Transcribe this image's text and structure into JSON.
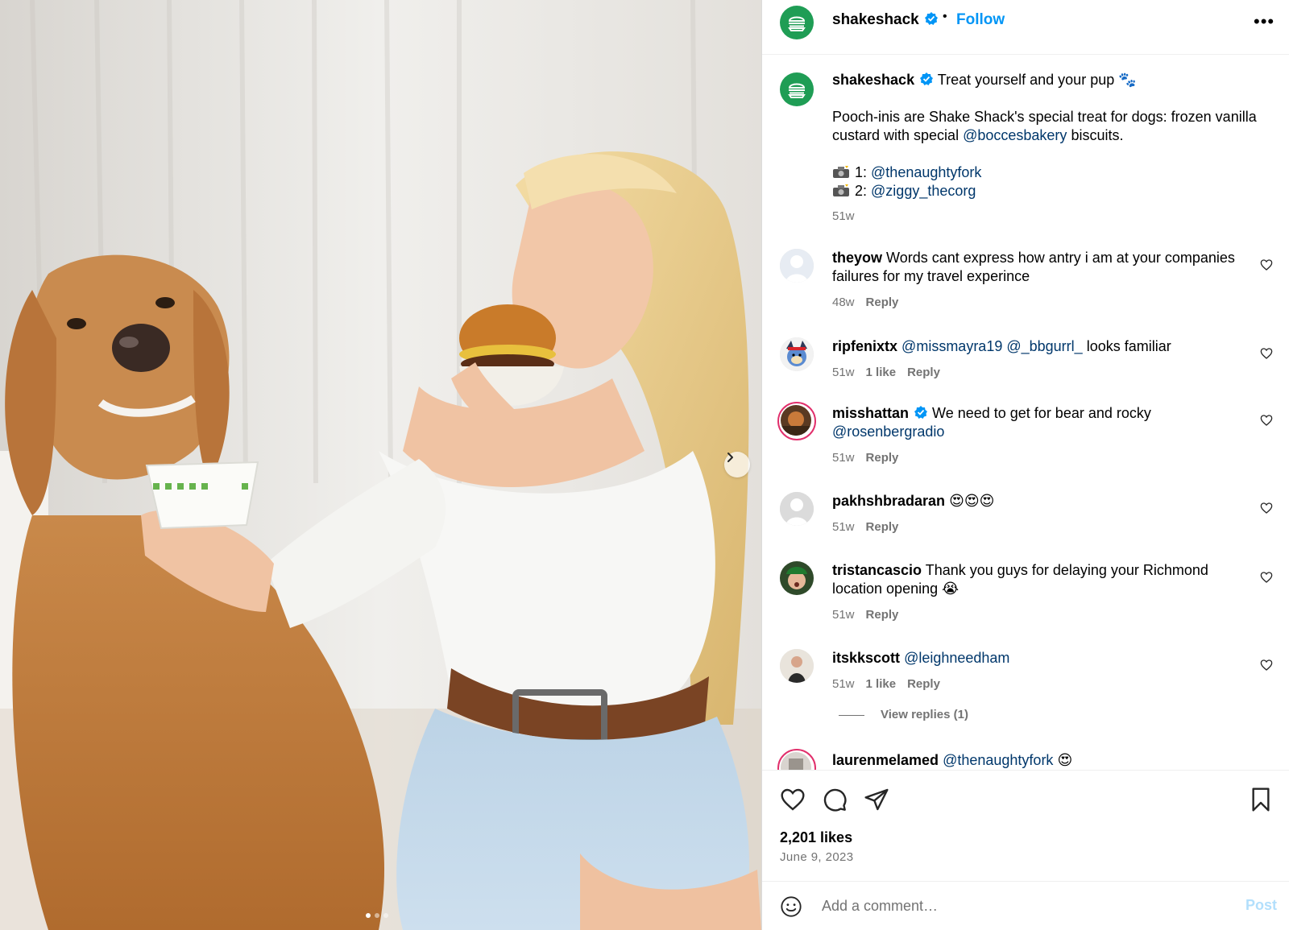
{
  "post": {
    "username": "shakeshack",
    "follow_label": "Follow",
    "separator": "•",
    "more_label": "•••",
    "caption": {
      "headline": "Treat yourself and your pup 🐾",
      "body_pre": "Pooch-inis are Shake Shack's special treat for dogs: frozen vanilla custard with special",
      "body_mention": "@boccesbakery",
      "body_post": "biscuits.",
      "credit1_prefix": "1:",
      "credit1_mention": "@thenaughtyfork",
      "credit2_prefix": "2:",
      "credit2_mention": "@ziggy_thecorg",
      "time": "51w"
    },
    "comments": [
      {
        "user": "theyow",
        "text": "Words cant express how antry i am at your companies failures for my travel experince",
        "time": "48w",
        "likes": "",
        "reply": "Reply"
      },
      {
        "user": "ripfenixtx",
        "mention1": "@missmayra19",
        "mention2": "@_bbgurrl_",
        "text": "looks familiar",
        "time": "51w",
        "likes": "1 like",
        "reply": "Reply"
      },
      {
        "user": "misshattan",
        "text": "We need to get for bear and rocky",
        "mention": "@rosenbergradio",
        "time": "51w",
        "likes": "",
        "reply": "Reply"
      },
      {
        "user": "pakhshbradaran",
        "text": "😍😍😍",
        "time": "51w",
        "likes": "",
        "reply": "Reply"
      },
      {
        "user": "tristancascio",
        "text": "Thank you guys for delaying your Richmond location opening 😭",
        "time": "51w",
        "likes": "",
        "reply": "Reply"
      },
      {
        "user": "itskkscott",
        "mention": "@leighneedham",
        "time": "51w",
        "likes": "1 like",
        "reply": "Reply"
      },
      {
        "user": "laurenmelamed",
        "mention": "@thenaughtyfork",
        "text": "😍"
      }
    ],
    "view_replies": "View replies (1)",
    "likes": "2,201 likes",
    "date": "June 9, 2023",
    "comment_placeholder": "Add a comment…",
    "post_label": "Post"
  },
  "carousel": {
    "count": 3,
    "active": 0
  }
}
